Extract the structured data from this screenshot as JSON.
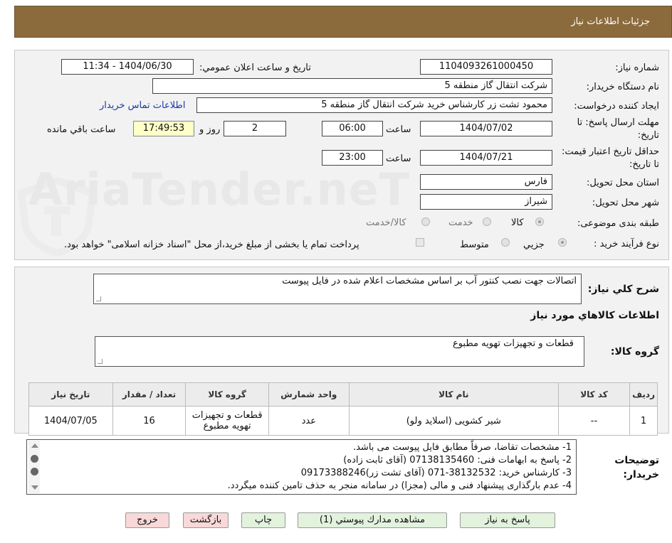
{
  "header": {
    "title": "جزئيات اطلاعات نياز"
  },
  "watermark": {
    "text": "AriaTender.neT"
  },
  "form": {
    "need_number_label": "شماره نياز:",
    "need_number": "1104093261000450",
    "announce_label": "تاريخ و ساعت اعلان عمومي:",
    "announce_value": "1404/06/30 - 11:34",
    "buyer_org_label": "نام دستگاه خريدار:",
    "buyer_org": "شركت انتقال گاز منطقه 5",
    "requester_label": "ايجاد كننده درخواست:",
    "requester": "محمود تشت زر كارشناس خريد شركت انتقال گاز منطقه 5",
    "contact_link": "اطلاعات تماس خريدار",
    "reply_deadline_label": "مهلت ارسال پاسخ: تا تاريخ:",
    "reply_date": "1404/07/02",
    "time_word": "ساعت",
    "reply_time": "06:00",
    "days_value": "2",
    "days_word": "روز و",
    "remaining_time": "17:49:53",
    "remaining_word": "ساعت باقي مانده",
    "price_validity_label": "حداقل تاريخ اعتبار قيمت: تا تاريخ:",
    "price_date": "1404/07/21",
    "price_time": "23:00",
    "province_label": "استان محل تحويل:",
    "province": "فارس",
    "city_label": "شهر محل تحويل:",
    "city": "شيراز",
    "category_label": "طبقه بندی موضوعی:",
    "category_options": [
      "كالا",
      "خدمت",
      "كالا/خدمت"
    ],
    "process_label": "نوع فرآيند خريد :",
    "process_options": [
      "جزيي",
      "متوسط"
    ],
    "payment_note": "پرداخت تمام يا بخشی از مبلغ خريد،از محل \"اسناد خزانه اسلامی\" خواهد بود."
  },
  "summary": {
    "label": "شرح كلي نياز:",
    "value": "اتصالات جهت نصب كنتور آب بر اساس مشخصات اعلام شده در فايل پيوست"
  },
  "goods_section": {
    "title": "اطلاعات كالاهاي مورد نياز",
    "group_label": "گروه كالا:",
    "group_value": "قطعات و تجهيزات تهويه مطبوع"
  },
  "table": {
    "headers": [
      "رديف",
      "كد كالا",
      "نام كالا",
      "واحد شمارش",
      "گروه كالا",
      "تعداد / مقدار",
      "تاريخ نياز"
    ],
    "rows": [
      [
        "1",
        "--",
        "شير كشويی (اسلايد ولو)",
        "عدد",
        "قطعات و تجهيزات تهويه مطبوع",
        "16",
        "1404/07/05"
      ]
    ]
  },
  "notes": {
    "label": "توضيحات خريدار:",
    "lines": [
      "1-  مشخصات تقاضا، صرفاً مطابق فايل پيوست می باشد.",
      "2- پاسخ به ابهامات فنی: 07138135460 (آقای ثابت زاده)",
      "3- كارشناس خريد: 38132532-071 (آقای تشت زر)09173388246",
      "4- عدم بارگذاری پيشنهاد فنی و مالی (مجزا) در سامانه منجر به حذف تامين كننده ميگردد."
    ]
  },
  "buttons": {
    "reply": "پاسخ به نياز",
    "attachments": "مشاهده مدارك پيوستي (1)",
    "print": "چاپ",
    "back": "بازگشت",
    "exit": "خروج"
  }
}
